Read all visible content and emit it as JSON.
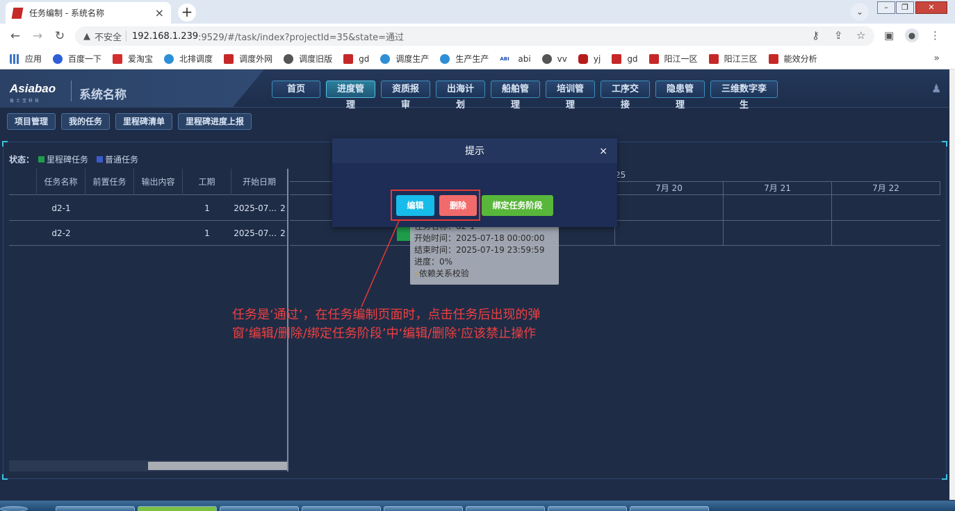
{
  "browser": {
    "tab_title": "任务编制 - 系统名称",
    "insecure_label": "不安全",
    "url_host": "192.168.1.239",
    "url_rest": ":9529/#/task/index?projectId=35&state=通过",
    "bookmarks": [
      "应用",
      "百度一下",
      "爱淘宝",
      "北排调度",
      "调度外网",
      "调度旧版",
      "gd",
      "调度生产",
      "生产生产",
      "abi",
      "vv",
      "yj",
      "gd",
      "阳江一区",
      "阳江三区",
      "能效分析"
    ],
    "bookmark_more": "»"
  },
  "app": {
    "logo": "Asiabao",
    "logo_sub": "易士宝科技",
    "system_name": "系统名称",
    "main_nav": [
      "首页",
      "进度管理",
      "资质报审",
      "出海计划",
      "船舶管理",
      "培训管理",
      "工序交接",
      "隐患管理",
      "三维数字孪生"
    ],
    "active_nav": "进度管理",
    "sub_nav": [
      "项目管理",
      "我的任务",
      "里程碑清单",
      "里程碑进度上报"
    ]
  },
  "legend": {
    "label": "状态：",
    "items": [
      {
        "name": "里程碑任务",
        "color": "#1f9d4a"
      },
      {
        "name": "普通任务",
        "color": "#3a5bd0"
      }
    ]
  },
  "table": {
    "columns": [
      "任务名称",
      "前置任务",
      "输出内容",
      "工期",
      "开始日期"
    ],
    "rows": [
      {
        "name": "d2-1",
        "pre": "",
        "output": "",
        "duration": "1",
        "start": "2025-07...",
        "extra": "2"
      },
      {
        "name": "d2-2",
        "pre": "",
        "output": "",
        "duration": "1",
        "start": "2025-07...",
        "extra": "2"
      }
    ]
  },
  "gantt": {
    "month_label": "25",
    "days": [
      "7",
      "",
      "",
      "7月 20",
      "7月 21",
      "7月 22"
    ]
  },
  "tooltip": {
    "name_line": "任务名称：d2-1",
    "start_line": "开始时间：2025-07-18 00:00:00",
    "end_line": "结束时间：2025-07-19 23:59:59",
    "progress_line": "进度：0%",
    "dep_line": "依赖关系校验"
  },
  "modal": {
    "title": "提示",
    "close": "×",
    "edit": "编辑",
    "delete": "删除",
    "bind": "绑定任务阶段"
  },
  "annotation": {
    "line1": "任务是‘通过’，在任务编制页面时，点击任务后出现的弹",
    "line2": "窗‘编辑/删除/绑定任务阶段’中‘编辑/删除’应该禁止操作"
  }
}
